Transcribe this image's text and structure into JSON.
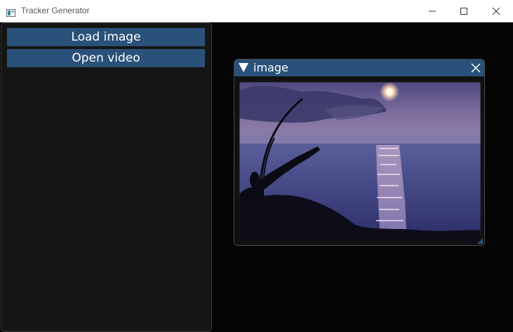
{
  "window": {
    "title": "Tracker Generator"
  },
  "sidebar": {
    "load_label": "Load image",
    "video_label": "Open video"
  },
  "image_window": {
    "title": "image",
    "content": "photo of a sunset over the sea with silhouetted shoreline and fishing rod"
  },
  "colors": {
    "accent": "#2a5179",
    "background": "#050505",
    "panel": "#151515"
  },
  "icons": [
    "app-icon",
    "minimize-icon",
    "maximize-icon",
    "close-icon",
    "collapse-triangle-icon",
    "window-close-icon"
  ]
}
